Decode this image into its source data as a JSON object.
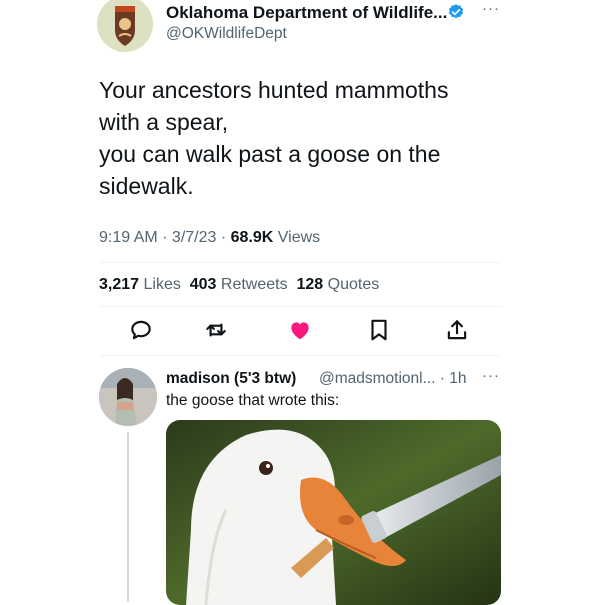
{
  "tweet": {
    "display_name": "Oklahoma Department of Wildlife...",
    "handle": "@OKWildlifeDept",
    "more_label": "···",
    "text_lines": [
      "Your ancestors hunted mammoths",
      "with a spear,",
      "you can walk past a goose on the",
      "sidewalk."
    ],
    "time": "9:19 AM",
    "date": "3/7/23",
    "views_count": "68.9K",
    "views_label": "Views",
    "likes_count": "3,217",
    "likes_label": "Likes",
    "retweets_count": "403",
    "retweets_label": "Retweets",
    "quotes_count": "128",
    "quotes_label": "Quotes",
    "liked": true
  },
  "actions": [
    {
      "name": "reply",
      "icon": "comment-icon"
    },
    {
      "name": "retweet",
      "icon": "retweet-icon"
    },
    {
      "name": "like",
      "icon": "heart-icon"
    },
    {
      "name": "bookmark",
      "icon": "bookmark-icon"
    },
    {
      "name": "share",
      "icon": "share-icon"
    }
  ],
  "reply": {
    "display_name": "madison (5'3 btw)",
    "handle_time": "@madsmotionl... · 1h",
    "more_label": "···",
    "text": "the goose that wrote this:"
  },
  "colors": {
    "verified": "#1d9bf0",
    "like": "#f91880",
    "muted": "#536471",
    "text": "#0f1419"
  }
}
